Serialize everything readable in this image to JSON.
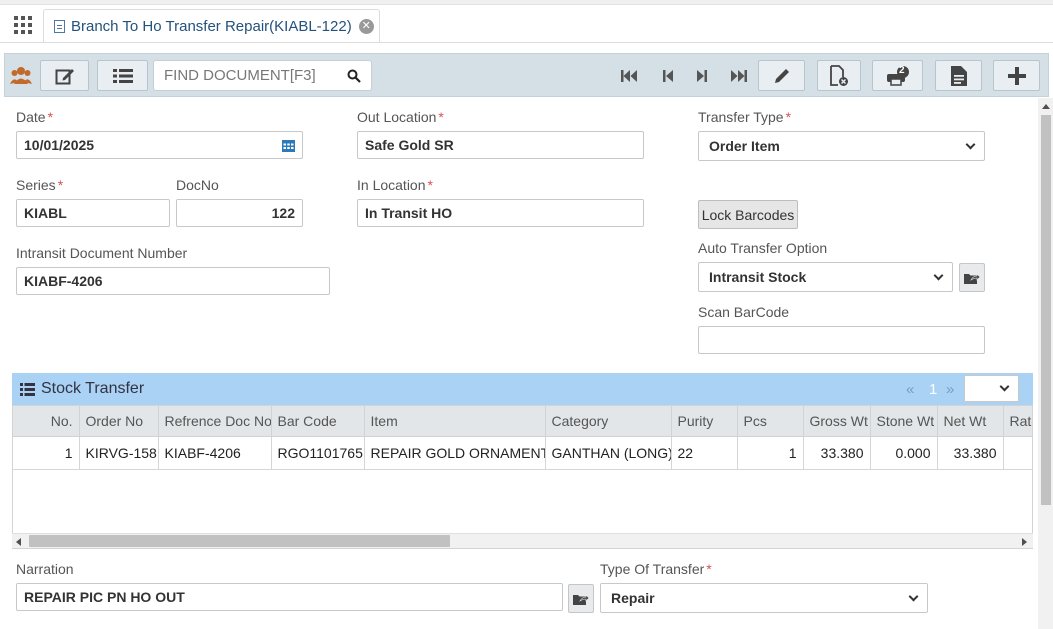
{
  "tab": {
    "title": "Branch To Ho Transfer Repair(KIABL-122)"
  },
  "toolbar": {
    "search_placeholder": "FIND DOCUMENT[F3]",
    "print_badge": "2"
  },
  "form": {
    "date": {
      "label": "Date",
      "value": "10/01/2025"
    },
    "out_location": {
      "label": "Out Location",
      "value": "Safe Gold SR"
    },
    "transfer_type": {
      "label": "Transfer Type",
      "value": "Order Item"
    },
    "series": {
      "label": "Series",
      "value": "KIABL"
    },
    "docno": {
      "label": "DocNo",
      "value": "122"
    },
    "in_location": {
      "label": "In Location",
      "value": "In Transit HO"
    },
    "lock_barcodes": "Lock Barcodes",
    "intransit_doc": {
      "label": "Intransit Document Number",
      "value": "KIABF-4206"
    },
    "auto_transfer": {
      "label": "Auto Transfer Option",
      "value": "Intransit Stock"
    },
    "scan_barcode": {
      "label": "Scan BarCode",
      "value": ""
    },
    "required_mark": "*"
  },
  "grid": {
    "title": "Stock Transfer",
    "pager": {
      "prev": "«",
      "page": "1",
      "next": "»",
      "size": ""
    },
    "columns": [
      "No.",
      "Order No",
      "Refrence Doc No",
      "Bar Code",
      "Item",
      "Category",
      "Purity",
      "Pcs",
      "Gross Wt",
      "Stone Wt",
      "Net Wt",
      "Rate"
    ],
    "rows": [
      [
        "1",
        "KIRVG-158",
        "KIABF-4206",
        "RGO1101765",
        "REPAIR GOLD ORNAMENT",
        "GANTHAN (LONG)",
        "22",
        "1",
        "33.380",
        "0.000",
        "33.380",
        ""
      ]
    ]
  },
  "footer": {
    "narration": {
      "label": "Narration",
      "value": "REPAIR PIC PN HO OUT"
    },
    "type_of_transfer": {
      "label": "Type Of Transfer",
      "value": "Repair"
    }
  },
  "colors": {
    "toolbar_bg": "#d5dfe6",
    "grid_header_bg": "#a9d2f5",
    "tab_text": "#23527c",
    "required": "#d9534f"
  }
}
